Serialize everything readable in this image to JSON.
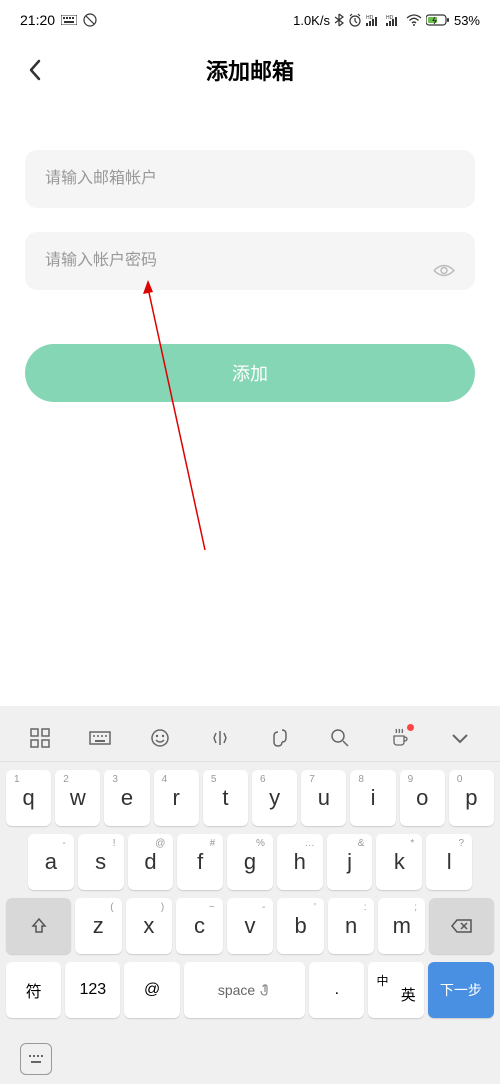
{
  "status": {
    "time": "21:20",
    "speed": "1.0K/s",
    "battery": "53%"
  },
  "nav": {
    "title": "添加邮箱"
  },
  "form": {
    "email_placeholder": "请输入邮箱帐户",
    "password_placeholder": "请输入帐户密码",
    "add_button": "添加"
  },
  "keyboard": {
    "row1": [
      {
        "n": "1",
        "k": "q"
      },
      {
        "n": "2",
        "k": "w"
      },
      {
        "n": "3",
        "k": "e"
      },
      {
        "n": "4",
        "k": "r"
      },
      {
        "n": "5",
        "k": "t"
      },
      {
        "n": "6",
        "k": "y"
      },
      {
        "n": "7",
        "k": "u"
      },
      {
        "n": "8",
        "k": "i"
      },
      {
        "n": "9",
        "k": "o"
      },
      {
        "n": "0",
        "k": "p"
      }
    ],
    "row2": [
      {
        "n": "-",
        "k": "a"
      },
      {
        "n": "!",
        "k": "s"
      },
      {
        "n": "@",
        "k": "d"
      },
      {
        "n": "#",
        "k": "f"
      },
      {
        "n": "%",
        "k": "g"
      },
      {
        "n": "…",
        "k": "h"
      },
      {
        "n": "&",
        "k": "j"
      },
      {
        "n": "*",
        "k": "k"
      },
      {
        "n": "?",
        "k": "l"
      }
    ],
    "row3": [
      {
        "n": "(",
        "k": "z"
      },
      {
        "n": ")",
        "k": "x"
      },
      {
        "n": "~",
        "k": "c"
      },
      {
        "n": "-",
        "k": "v"
      },
      {
        "n": "'",
        "k": "b"
      },
      {
        "n": ":",
        "k": "n"
      },
      {
        "n": ";",
        "k": "m"
      }
    ],
    "fn": {
      "sym": "符",
      "num": "123",
      "at": "@",
      "space": "space",
      "dot": ".",
      "lang_top": "中",
      "lang_bot": "英",
      "next": "下一步"
    }
  }
}
